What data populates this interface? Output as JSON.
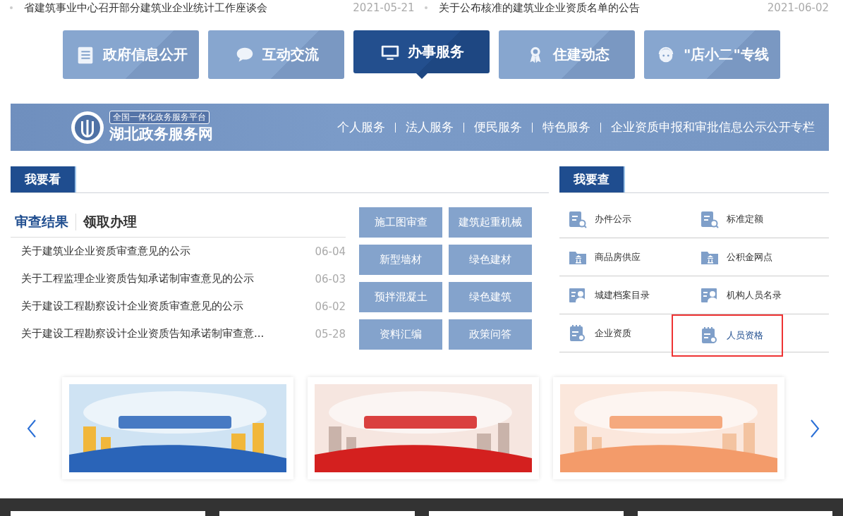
{
  "news_ticker": [
    {
      "title": "省建筑事业中心召开部分建筑业企业统计工作座谈会",
      "date": "2021-05-21"
    },
    {
      "title": "关于公布核准的建筑业企业资质名单的公告",
      "date": "2021-06-02"
    }
  ],
  "main_nav": [
    {
      "label": "政府信息公开",
      "kind": "list",
      "selected": false
    },
    {
      "label": "互动交流",
      "kind": "chat",
      "selected": false
    },
    {
      "label": "办事服务",
      "kind": "monitor",
      "selected": true
    },
    {
      "label": "住建动态",
      "kind": "medal",
      "selected": false
    },
    {
      "label": "\"店小二\"专线",
      "kind": "headset",
      "selected": false
    }
  ],
  "service_banner": {
    "logo_top": "全国一体化政务服务平台",
    "logo_name": "湖北政务服务网",
    "links": [
      "个人服务",
      "法人服务",
      "便民服务",
      "特色服务",
      "企业资质申报和审批信息公示公开专栏"
    ]
  },
  "look_section": {
    "title": "我要看",
    "tabs": [
      {
        "label": "审查结果",
        "selected": true
      },
      {
        "label": "领取办理",
        "selected": false
      }
    ],
    "items": [
      {
        "title": "关于建筑业企业资质审查意见的公示",
        "date": "06-04"
      },
      {
        "title": "关于工程监理企业资质告知承诺制审查意见的公示",
        "date": "06-03"
      },
      {
        "title": "关于建设工程勘察设计企业资质审查意见的公示",
        "date": "06-02"
      },
      {
        "title": "关于建设工程勘察设计企业资质告知承诺制审查意...",
        "date": "05-28"
      }
    ],
    "tiles": [
      "施工图审查",
      "建筑起重机械",
      "新型墙材",
      "绿色建材",
      "预拌混凝土",
      "绿色建筑",
      "资料汇编",
      "政策问答"
    ]
  },
  "query_section": {
    "title": "我要查",
    "items": [
      {
        "label": "办件公示",
        "kind": "clipboard",
        "highlighted": false
      },
      {
        "label": "标准定额",
        "kind": "clipboard",
        "highlighted": false
      },
      {
        "label": "商品房供应",
        "kind": "folder",
        "highlighted": false
      },
      {
        "label": "公积金网点",
        "kind": "folder",
        "highlighted": false
      },
      {
        "label": "城建档案目录",
        "kind": "person",
        "highlighted": false
      },
      {
        "label": "机构人员名录",
        "kind": "person",
        "highlighted": false
      },
      {
        "label": "企业资质",
        "kind": "notepad",
        "highlighted": false
      },
      {
        "label": "人员资格",
        "kind": "notepad",
        "highlighted": true
      }
    ]
  }
}
